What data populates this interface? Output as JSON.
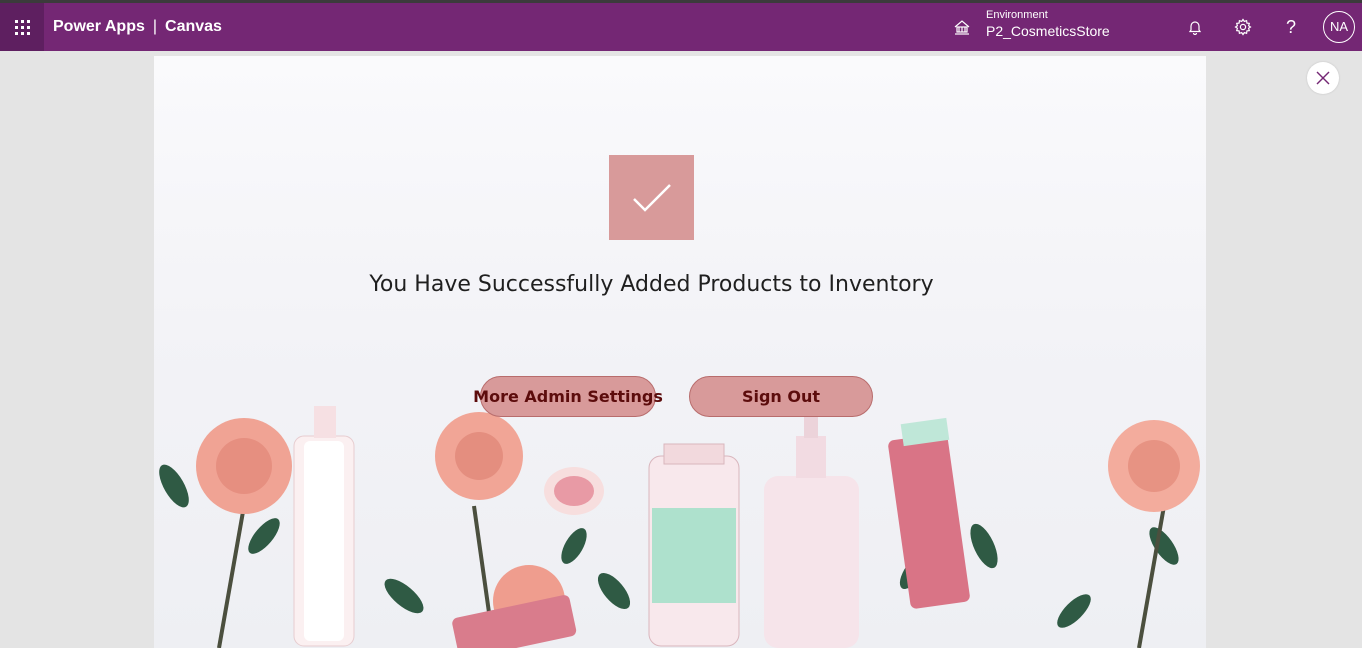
{
  "header": {
    "app_name": "Power Apps",
    "separator": "|",
    "section": "Canvas",
    "environment_label": "Environment",
    "environment_name": "P2_CosmeticsStore",
    "user_initials": "NA",
    "help_glyph": "?",
    "icons": [
      "waffle-icon",
      "environment-icon",
      "bell-icon",
      "gear-icon",
      "help-icon"
    ]
  },
  "screen": {
    "message": "You Have Successfully Added Products to Inventory",
    "buttons": {
      "admin_label": "More Admin Settings",
      "signout_label": "Sign Out"
    },
    "icons": [
      "checkmark-icon",
      "close-icon"
    ]
  },
  "colors": {
    "header_bg": "#742774",
    "waffle_bg": "#5e1f60",
    "accent_pink": "#d89a9a",
    "button_text": "#5c0c0c",
    "page_bg": "#e4e4e4"
  }
}
